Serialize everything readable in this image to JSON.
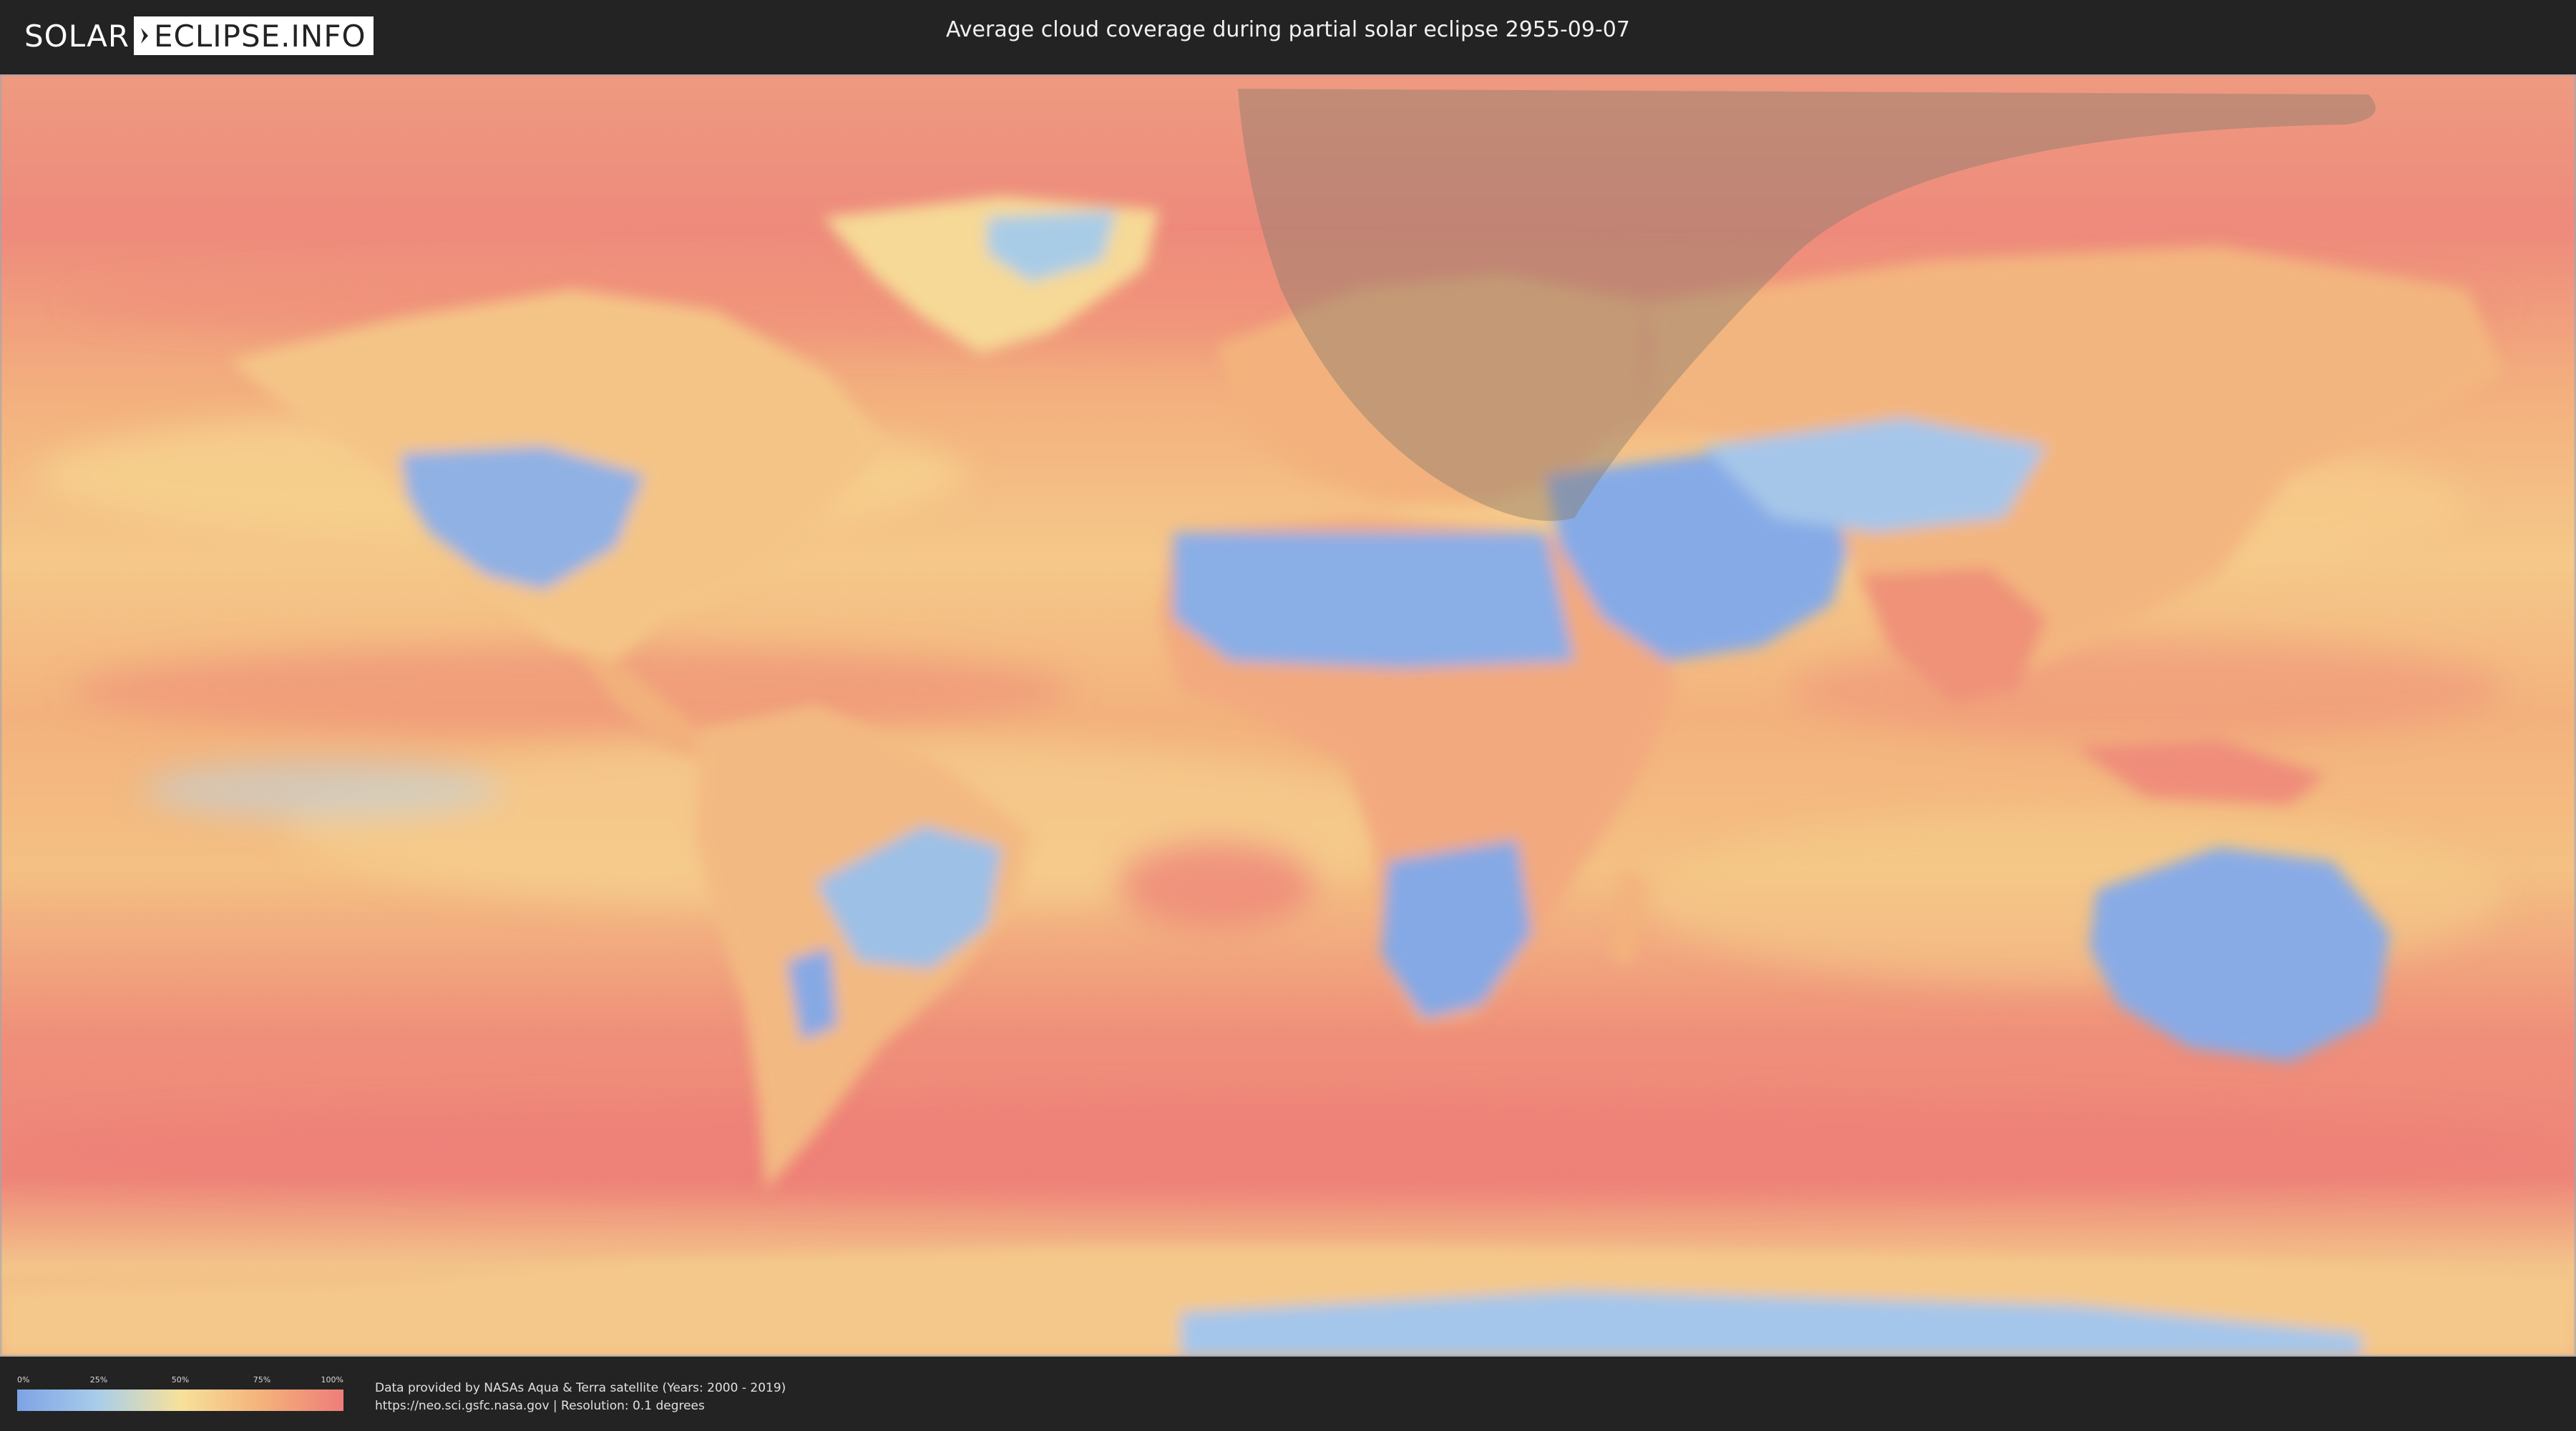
{
  "header": {
    "logo_left": "SOLAR",
    "logo_right": "ECLIPSE.INFO",
    "title": "Average cloud coverage during partial solar eclipse 2955-09-07"
  },
  "map": {
    "layer": "average cloud coverage",
    "eclipse_type": "partial",
    "date": "2955-09-07",
    "shadow_color": "#8a7d6c",
    "low_cloud_color": "#7da3e6",
    "high_cloud_color": "#ee7d79"
  },
  "legend": {
    "ticks": [
      "0%",
      "25%",
      "50%",
      "75%",
      "100%"
    ],
    "colors": [
      "#7da3e6",
      "#a9cde9",
      "#f7e19b",
      "#f4b27b",
      "#ee7d79"
    ]
  },
  "footer": {
    "credit_line1": "Data provided by NASAs Aqua & Terra satellite (Years: 2000 - 2019)",
    "credit_line2": "https://neo.sci.gsfc.nasa.gov | Resolution: 0.1 degrees"
  }
}
